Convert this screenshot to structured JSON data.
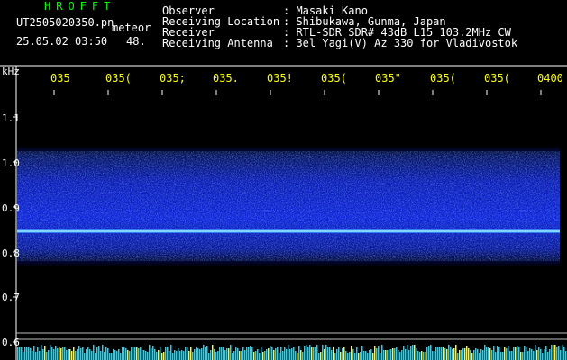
{
  "header": {
    "brand": "HROFFT",
    "filename": "UT2505020350.pn",
    "event": "meteor",
    "datetime": "25.05.02 03:50",
    "count": "48."
  },
  "info": [
    {
      "label": "Observer",
      "value": ": Masaki Kano"
    },
    {
      "label": "Receiving Location",
      "value": ": Shibukawa, Gunma, Japan"
    },
    {
      "label": "Receiver",
      "value": ": RTL-SDR SDR# 43dB L15 103.2MHz CW"
    },
    {
      "label": "Receiving Antenna",
      "value": ": 3el Yagi(V) Az 330 for Vladivostok"
    }
  ],
  "axis": {
    "unit": "kHz",
    "x_ticks": [
      "035",
      "035(",
      "035;",
      "035.",
      "035!",
      "035(",
      "035\"",
      "035(",
      "035(",
      "0400"
    ],
    "y_ticks": [
      "1.1",
      "1.0",
      "0.9",
      "0.8",
      "0.7",
      "0.6"
    ]
  },
  "colors": {
    "background": "#000000",
    "noise_band": "#0a14c8",
    "signal_line": "#7fe0ff",
    "bottom_bars": "#00e0ff",
    "bottom_highlight": "#ffff00"
  }
}
